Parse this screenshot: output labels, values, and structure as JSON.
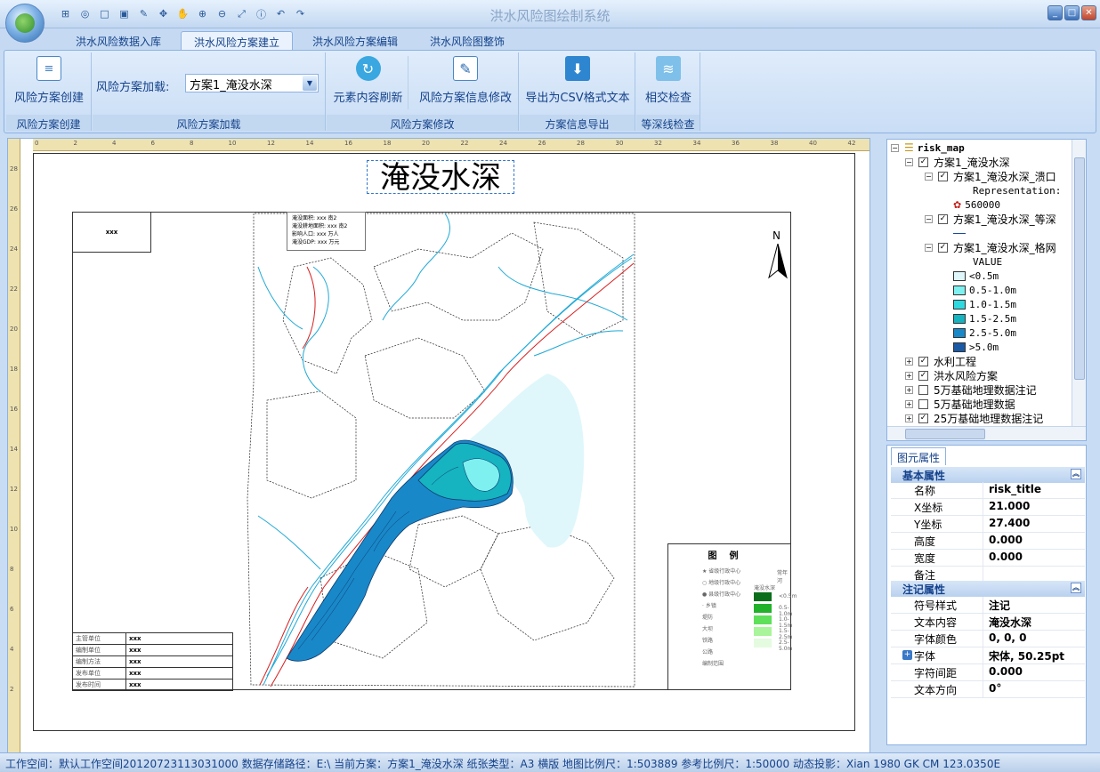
{
  "window": {
    "title": "洪水风险图绘制系统"
  },
  "quick_access": [
    "tree-icon",
    "zoom-extent-icon",
    "new-icon",
    "save-icon",
    "edit-icon",
    "pan-icon",
    "hand-icon",
    "zoom-in-icon",
    "zoom-out-icon",
    "full-extent-icon",
    "info-icon",
    "undo-icon",
    "redo-icon"
  ],
  "tabs": [
    "洪水风险数据入库",
    "洪水风险方案建立",
    "洪水风险方案编辑",
    "洪水风险图整饰"
  ],
  "active_tab": "洪水风险方案建立",
  "ribbon": {
    "create_btn": "风险方案创建",
    "create_group": "风险方案创建",
    "load_label": "风险方案加载:",
    "load_value": "方案1_淹没水深",
    "load_group": "风险方案加载",
    "refresh_btn": "元素内容刷新",
    "info_edit_btn": "风险方案信息修改",
    "modify_group": "风险方案修改",
    "export_btn": "导出为CSV格式文本",
    "export_group": "方案信息导出",
    "check_btn": "相交检查",
    "check_group": "等深线检查"
  },
  "ruler": {
    "h": [
      "0",
      "2",
      "4",
      "6",
      "8",
      "10",
      "12",
      "14",
      "16",
      "18",
      "20",
      "22",
      "24",
      "26",
      "28",
      "30",
      "32",
      "34",
      "36",
      "38",
      "40",
      "42"
    ],
    "v": [
      "28",
      "26",
      "24",
      "22",
      "20",
      "18",
      "16",
      "14",
      "12",
      "10",
      "8",
      "6",
      "4",
      "2"
    ]
  },
  "map": {
    "title": "淹没水深",
    "header_text": "xxx",
    "stats": [
      "淹没面积: xxx 南2",
      "淹没耕地面积: xxx 南2",
      "影响人口: xxx 万人",
      "淹没GDP: xxx 万元"
    ],
    "info_table": [
      {
        "k": "主管单位",
        "v": "xxx"
      },
      {
        "k": "编制单位",
        "v": "xxx"
      },
      {
        "k": "编制方法",
        "v": "xxx"
      },
      {
        "k": "发布单位",
        "v": "xxx"
      },
      {
        "k": "发布时间",
        "v": "xxx"
      }
    ],
    "compass_label": "N",
    "legend": {
      "title": "图例",
      "left": [
        "省级行政中心",
        "地级行政中心",
        "县级行政中心",
        "乡镇",
        "堤防",
        "大坝",
        "铁路",
        "公路",
        "编制范围"
      ],
      "right_line": "常年河",
      "depth_header": "淹没水深",
      "depth_rows": [
        "<0.5m",
        "0.5-1.0m",
        "1.0-1.5m",
        "1.5-2.5m",
        "2.5-5.0m"
      ],
      "depth_colors": [
        "#0a6e1a",
        "#22b22a",
        "#5fe05a",
        "#a9f59b",
        "#e4fbe0"
      ]
    }
  },
  "layers": {
    "root": "risk_map",
    "items": [
      {
        "label": "方案1_淹没水深",
        "level": 1,
        "checked": true,
        "exp": "-"
      },
      {
        "label": "方案1_淹没水深_溃口",
        "level": 2,
        "checked": true,
        "exp": "-"
      },
      {
        "label": "Representation:",
        "level": 3,
        "type": "text"
      },
      {
        "label": "560000",
        "level": 3,
        "type": "symbol"
      },
      {
        "label": "方案1_淹没水深_等深",
        "level": 2,
        "checked": true,
        "exp": "-"
      },
      {
        "label": "",
        "level": 3,
        "type": "line"
      },
      {
        "label": "方案1_淹没水深_格网",
        "level": 2,
        "checked": true,
        "exp": "-"
      },
      {
        "label": "VALUE",
        "level": 3,
        "type": "text"
      },
      {
        "label": "<0.5m",
        "level": 3,
        "type": "swatch",
        "color": "#dff7fb"
      },
      {
        "label": "0.5-1.0m",
        "level": 3,
        "type": "swatch",
        "color": "#7ff0f0"
      },
      {
        "label": "1.0-1.5m",
        "level": 3,
        "type": "swatch",
        "color": "#2fd9e0"
      },
      {
        "label": "1.5-2.5m",
        "level": 3,
        "type": "swatch",
        "color": "#16b3c0"
      },
      {
        "label": "2.5-5.0m",
        "level": 3,
        "type": "swatch",
        "color": "#1988c8"
      },
      {
        "label": ">5.0m",
        "level": 3,
        "type": "swatch",
        "color": "#1a59a6"
      },
      {
        "label": "水利工程",
        "level": 1,
        "checked": true,
        "exp": "+"
      },
      {
        "label": "洪水风险方案",
        "level": 1,
        "checked": true,
        "exp": "+"
      },
      {
        "label": "5万基础地理数据注记",
        "level": 1,
        "checked": false,
        "exp": "+"
      },
      {
        "label": "5万基础地理数据",
        "level": 1,
        "checked": false,
        "exp": "+"
      },
      {
        "label": "25万基础地理数据注记",
        "level": 1,
        "checked": true,
        "exp": "+"
      }
    ]
  },
  "properties": {
    "tab": "图元属性",
    "basic_section": "基本属性",
    "basic": [
      {
        "k": "名称",
        "v": "risk_title"
      },
      {
        "k": "X坐标",
        "v": "21.000"
      },
      {
        "k": "Y坐标",
        "v": "27.400"
      },
      {
        "k": "高度",
        "v": "0.000"
      },
      {
        "k": "宽度",
        "v": "0.000"
      },
      {
        "k": "备注",
        "v": ""
      }
    ],
    "annot_section": "注记属性",
    "annot": [
      {
        "k": "符号样式",
        "v": "注记"
      },
      {
        "k": "文本内容",
        "v": "淹没水深"
      },
      {
        "k": "字体颜色",
        "v": "0, 0, 0"
      },
      {
        "k": "字体",
        "v": "宋体, 50.25pt"
      },
      {
        "k": "字符间距",
        "v": "0.000"
      },
      {
        "k": "文本方向",
        "v": "0°"
      }
    ]
  },
  "status": "工作空间：默认工作空间20120723113031000 数据存储路径：E:\\  当前方案：方案1_淹没水深  纸张类型：A3 横版  地图比例尺：1:503889  参考比例尺：1:50000  动态投影：Xian 1980 GK CM 123.0350E"
}
